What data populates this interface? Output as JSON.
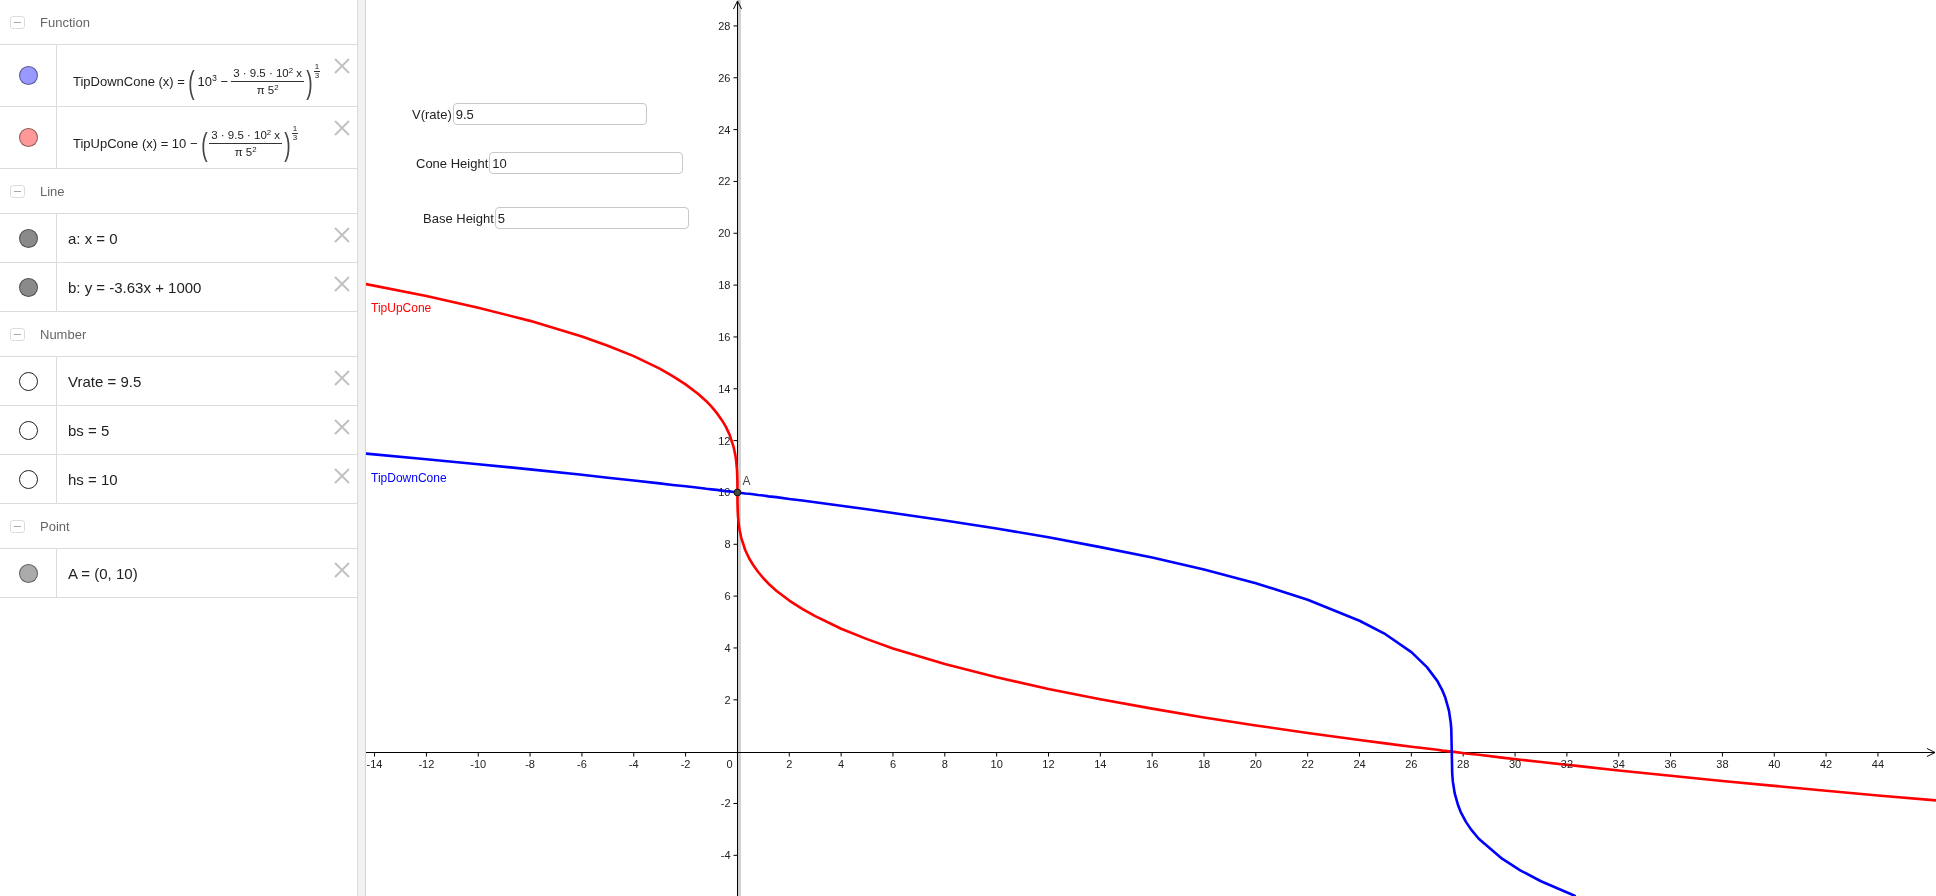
{
  "algebra_view": {
    "groups": [
      {
        "title": "Function",
        "expanded": true,
        "items": [
          {
            "kind": "formula",
            "visible": true,
            "color": "#9999ff",
            "parts": [
              {
                "kind": "text",
                "text": "TipDownCone (x) ="
              },
              {
                "kind": "big",
                "text": "("
              },
              {
                "kind": "text",
                "text": "10$^{3}$ −"
              },
              {
                "kind": "fraction",
                "numerator": "3 · 9.5 · 10$^{2}$ x",
                "denominator": "π 5$^{2}$"
              },
              {
                "kind": "big",
                "text": ")"
              },
              {
                "kind": "power",
                "numerator": "1",
                "denominator": "3"
              }
            ]
          },
          {
            "kind": "formula",
            "visible": true,
            "color": "#ff9999",
            "parts": [
              {
                "kind": "text",
                "text": "TipUpCone (x) = 10 −"
              },
              {
                "kind": "big",
                "text": "("
              },
              {
                "kind": "fraction",
                "numerator": "3 · 9.5 · 10$^{2}$ x",
                "denominator": "π 5$^{2}$"
              },
              {
                "kind": "big",
                "text": ")"
              },
              {
                "kind": "power",
                "numerator": "1",
                "denominator": "3"
              }
            ]
          }
        ]
      },
      {
        "title": "Line",
        "expanded": true,
        "items": [
          {
            "kind": "text",
            "visible": true,
            "color": "#8a8a8a",
            "text": "a: x = 0"
          },
          {
            "kind": "text",
            "visible": true,
            "color": "#8a8a8a",
            "text": "b: y = -3.63x + 1000"
          }
        ]
      },
      {
        "title": "Number",
        "expanded": true,
        "items": [
          {
            "kind": "text",
            "visible": false,
            "text": "Vrate = 9.5"
          },
          {
            "kind": "text",
            "visible": false,
            "text": "bs = 5"
          },
          {
            "kind": "text",
            "visible": false,
            "text": "hs = 10"
          }
        ]
      },
      {
        "title": "Point",
        "expanded": true,
        "items": [
          {
            "kind": "text",
            "visible": true,
            "color": "#ababab",
            "text": "A = (0, 10)"
          }
        ]
      }
    ]
  },
  "graphics_view": {
    "inputs": [
      {
        "label": "V(rate)",
        "value": "9.5"
      },
      {
        "label": "Cone Height",
        "value": "10"
      },
      {
        "label": "Base Height",
        "value": "5"
      }
    ],
    "origin_label": "0",
    "chart_data": {
      "type": "line",
      "xlim": [
        -14.33,
        46.24
      ],
      "ylim": [
        -5.57,
        29.0
      ],
      "xticks": [
        -14,
        -12,
        -10,
        -8,
        -6,
        -4,
        -2,
        2,
        4,
        6,
        8,
        10,
        12,
        14,
        16,
        18,
        20,
        22,
        24,
        26,
        28,
        30,
        32,
        34,
        36,
        38,
        40,
        42,
        44
      ],
      "yticks": [
        -4,
        -2,
        2,
        4,
        6,
        8,
        10,
        12,
        14,
        16,
        18,
        20,
        22,
        24,
        26,
        28
      ],
      "x": [
        -14.33,
        -12,
        -10,
        -8,
        -6,
        -5,
        -4,
        -3,
        -2.5,
        -2,
        -1.5,
        -1.2,
        -1,
        -0.8,
        -0.6,
        -0.45,
        -0.3,
        -0.15,
        -0.08,
        -0.05,
        -0.02,
        -0.01,
        -0.002,
        0,
        0.002,
        0.01,
        0.02,
        0.05,
        0.08,
        0.15,
        0.3,
        0.45,
        0.6,
        0.8,
        1,
        1.2,
        1.5,
        2,
        2.5,
        3,
        4,
        5,
        6,
        8,
        10,
        12,
        14,
        16,
        18,
        20,
        22,
        24,
        25,
        26,
        26.6,
        27,
        27.2,
        27.3,
        27.45,
        27.52,
        27.54,
        27.558,
        27.575,
        27.6,
        27.67,
        27.8,
        27.9,
        28.1,
        28.3,
        28.6,
        29.5,
        30.2,
        31,
        32.3,
        34,
        36,
        38,
        40,
        42,
        44,
        46.24
      ],
      "series": [
        {
          "name": "TipUpCone",
          "color": "#ff0000",
          "values": [
            18.04,
            17.58,
            17.13,
            16.62,
            16.02,
            15.66,
            15.26,
            14.78,
            14.49,
            14.17,
            13.79,
            13.52,
            13.31,
            13.07,
            12.79,
            12.54,
            12.22,
            11.76,
            11.43,
            11.22,
            10.9,
            10.71,
            10.42,
            10,
            9.58,
            9.29,
            9.1,
            8.78,
            8.57,
            8.24,
            7.78,
            7.46,
            7.21,
            6.93,
            6.69,
            6.48,
            6.21,
            5.83,
            5.51,
            5.23,
            4.74,
            4.34,
            3.98,
            3.38,
            2.87,
            2.42,
            2.02,
            1.66,
            1.32,
            1.01,
            0.72,
            0.45,
            0.32,
            0.19,
            0.12,
            0.07,
            0.04,
            0.03,
            0.01,
            0.01,
            0,
            0,
            0,
            -0.01,
            -0.01,
            -0.03,
            -0.04,
            -0.07,
            -0.09,
            -0.12,
            -0.23,
            -0.31,
            -0.4,
            -0.54,
            -0.73,
            -0.93,
            -1.13,
            -1.32,
            -1.51,
            -1.69,
            -1.88
          ]
        },
        {
          "name": "TipDownCone",
          "color": "#0000ff",
          "values": [
            11.5,
            11.28,
            11.09,
            10.89,
            10.68,
            10.57,
            10.46,
            10.35,
            10.29,
            10.24,
            10.18,
            10.14,
            10.12,
            10.1,
            10.07,
            10.05,
            10.04,
            10.02,
            10.01,
            10.01,
            10,
            10,
            10,
            10,
            10,
            10,
            10,
            9.99,
            9.99,
            9.98,
            9.96,
            9.95,
            9.93,
            9.9,
            9.88,
            9.85,
            9.82,
            9.75,
            9.69,
            9.62,
            9.49,
            9.35,
            9.21,
            8.92,
            8.61,
            8.27,
            7.89,
            7.49,
            7.03,
            6.5,
            5.86,
            5.05,
            4.53,
            3.84,
            3.26,
            2.73,
            2.35,
            2.11,
            1.58,
            1.11,
            0.87,
            0,
            -0.85,
            -1.15,
            -1.6,
            -2.06,
            -2.32,
            -2.7,
            -3,
            -3.36,
            -4.13,
            -4.58,
            -5,
            -5.56,
            null,
            null,
            null,
            null,
            null,
            null,
            null
          ]
        }
      ],
      "ref_lines": [
        {
          "axis": "x",
          "value": 0,
          "color": "#cfcfcf"
        }
      ],
      "annotations": [
        {
          "x": 0,
          "y": 10,
          "text": "A"
        }
      ]
    }
  }
}
